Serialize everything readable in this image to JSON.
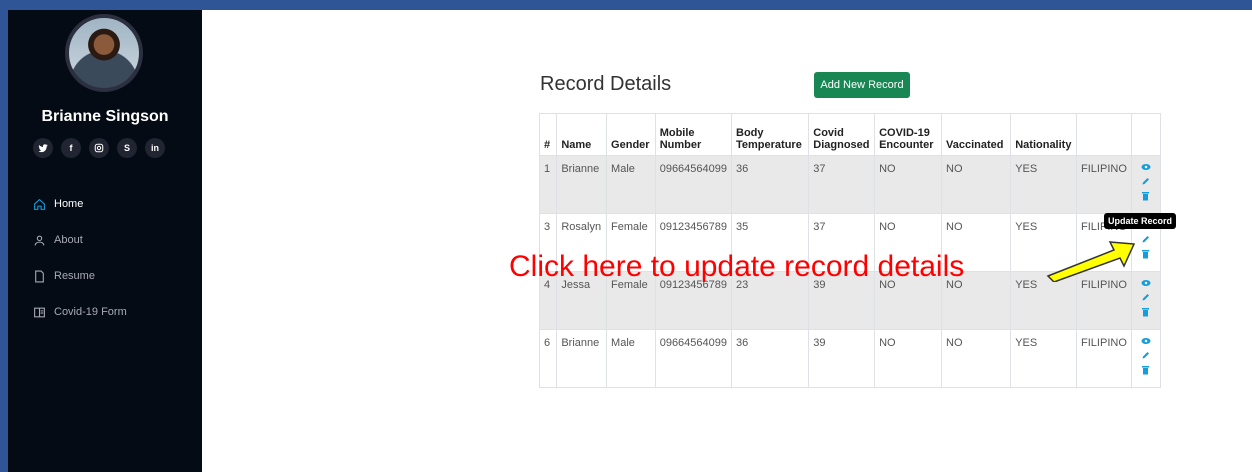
{
  "sidebar": {
    "name": "Brianne Singson",
    "socials": [
      {
        "icon": "twitter-icon",
        "glyph": "•"
      },
      {
        "icon": "facebook-icon",
        "glyph": "f"
      },
      {
        "icon": "instagram-icon",
        "glyph": "◎"
      },
      {
        "icon": "skype-icon",
        "glyph": "S"
      },
      {
        "icon": "linkedin-icon",
        "glyph": "in"
      }
    ],
    "nav": [
      {
        "label": "Home",
        "icon": "home-icon",
        "active": true
      },
      {
        "label": "About",
        "icon": "user-icon",
        "active": false
      },
      {
        "label": "Resume",
        "icon": "file-icon",
        "active": false
      },
      {
        "label": "Covid-19 Form",
        "icon": "form-icon",
        "active": false
      }
    ]
  },
  "main": {
    "title": "Record Details",
    "add_button": "Add New Record",
    "table": {
      "headers": [
        "#",
        "Name",
        "Gender",
        "Mobile Number",
        "Body Temperature",
        "Covid Diagnosed",
        "COVID-19 Encounter",
        "Vaccinated",
        "Nationality",
        ""
      ],
      "rows": [
        [
          "1",
          "Brianne",
          "Male",
          "09664564099",
          "36",
          "37",
          "NO",
          "NO",
          "YES",
          "FILIPINO"
        ],
        [
          "3",
          "Rosalyn",
          "Female",
          "09123456789",
          "35",
          "37",
          "NO",
          "NO",
          "YES",
          "FILIPINO"
        ],
        [
          "4",
          "Jessa",
          "Female",
          "09123456789",
          "23",
          "39",
          "NO",
          "NO",
          "YES",
          "FILIPINO"
        ],
        [
          "6",
          "Brianne",
          "Male",
          "09664564099",
          "36",
          "39",
          "NO",
          "NO",
          "YES",
          "FILIPINO"
        ]
      ]
    },
    "tooltip": "Update Record",
    "annotation": "Click here to update record details"
  },
  "colors": {
    "sidebar_bg": "#040b14",
    "accent": "#149ddd",
    "button_green": "#198754",
    "annotation_red": "#ff0000",
    "arrow_yellow": "#ffff00"
  }
}
